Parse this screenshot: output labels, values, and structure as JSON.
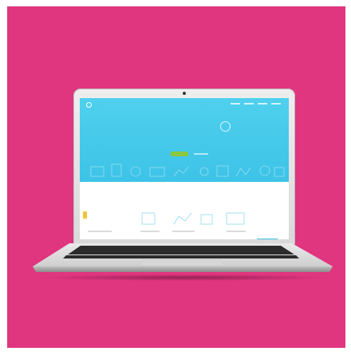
{
  "scene": {
    "background": "#e0357f",
    "object": "laptop"
  },
  "screen": {
    "brand_color": "#3dc3e7",
    "cta_color": "#8dc63f",
    "accent_tab_color": "#f5c33b",
    "logo_text": "",
    "hero_title": "",
    "hero_subtitle": "",
    "cta_label": "",
    "section_title": "",
    "section_text": ""
  }
}
